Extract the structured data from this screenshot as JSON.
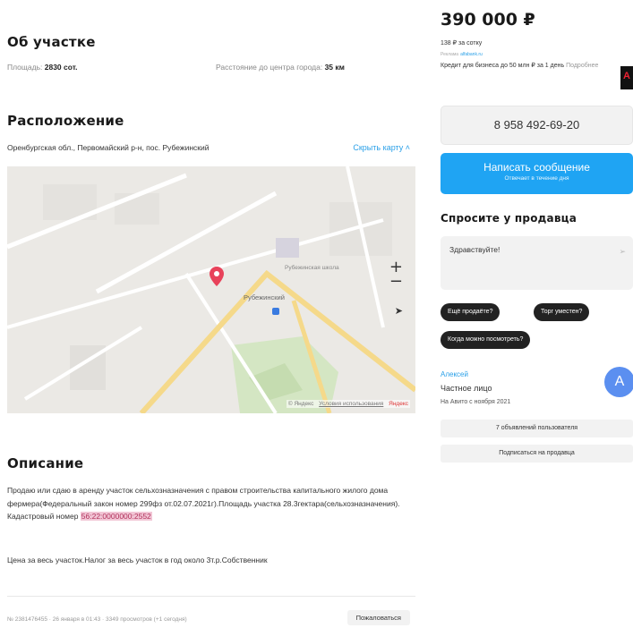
{
  "about": {
    "title": "Об участке",
    "area_label": "Площадь:",
    "area_value": "2830 сот.",
    "distance_label": "Расстояние до центра города:",
    "distance_value": "35 км"
  },
  "location": {
    "title": "Расположение",
    "address": "Оренбургская обл., Первомайский р-н, пос. Рубежинский",
    "hide_map": "Скрыть карту ˄",
    "map_labels": {
      "school": "Рубежинская школа",
      "village": "Рубежинский"
    },
    "map_footer": {
      "yandex_copy": "© Яндекс",
      "terms": "Условия использования",
      "brand": "Яндекс"
    },
    "marker_icon": "map-pin-icon",
    "marker_color": "#e8425a"
  },
  "description": {
    "title": "Описание",
    "text_before": "Продаю или сдаю в аренду участок сельхозназначения с правом строительства капитального жилого дома фермера(Федеральный закон номер 299фз от.02.07.2021г).Площадь участка 28.3гектара(сельхозназначения). Кадастровый номер ",
    "cadastral": "56:22:0000000:2552",
    "text2": "Цена за весь участок.Налог за весь участок в год около 3т.р.Собственник"
  },
  "footer": {
    "meta": "№ 2381476455 · 26 января в 01:43 · 3349 просмотров (+1 сегодня)",
    "report": "Пожаловаться"
  },
  "sidebar": {
    "price": "390 000 ₽",
    "per_sotka": "138 ₽ за сотку",
    "ad_label": "Реклама",
    "ad_source": "alfabank.ru",
    "ad_text": "Кредит для бизнеса до 50 млн ₽ за 1 день",
    "ad_more": "Подробнее",
    "ad_logo": "А",
    "phone": "8 958 492-69-20",
    "message_button": "Написать сообщение",
    "message_sub": "Отвечает в течение дня",
    "ask_title": "Спросите у продавца",
    "ask_text": "Здравствуйте!",
    "chips": [
      "Ещё продаёте?",
      "Торг уместен?",
      "Когда можно посмотреть?"
    ],
    "seller_name": "Алексей",
    "seller_type": "Частное лицо",
    "seller_since": "На Авито с ноября 2021",
    "avatar_letter": "A",
    "user_ads": "7 объявлений пользователя",
    "subscribe": "Подписаться на продавца"
  }
}
